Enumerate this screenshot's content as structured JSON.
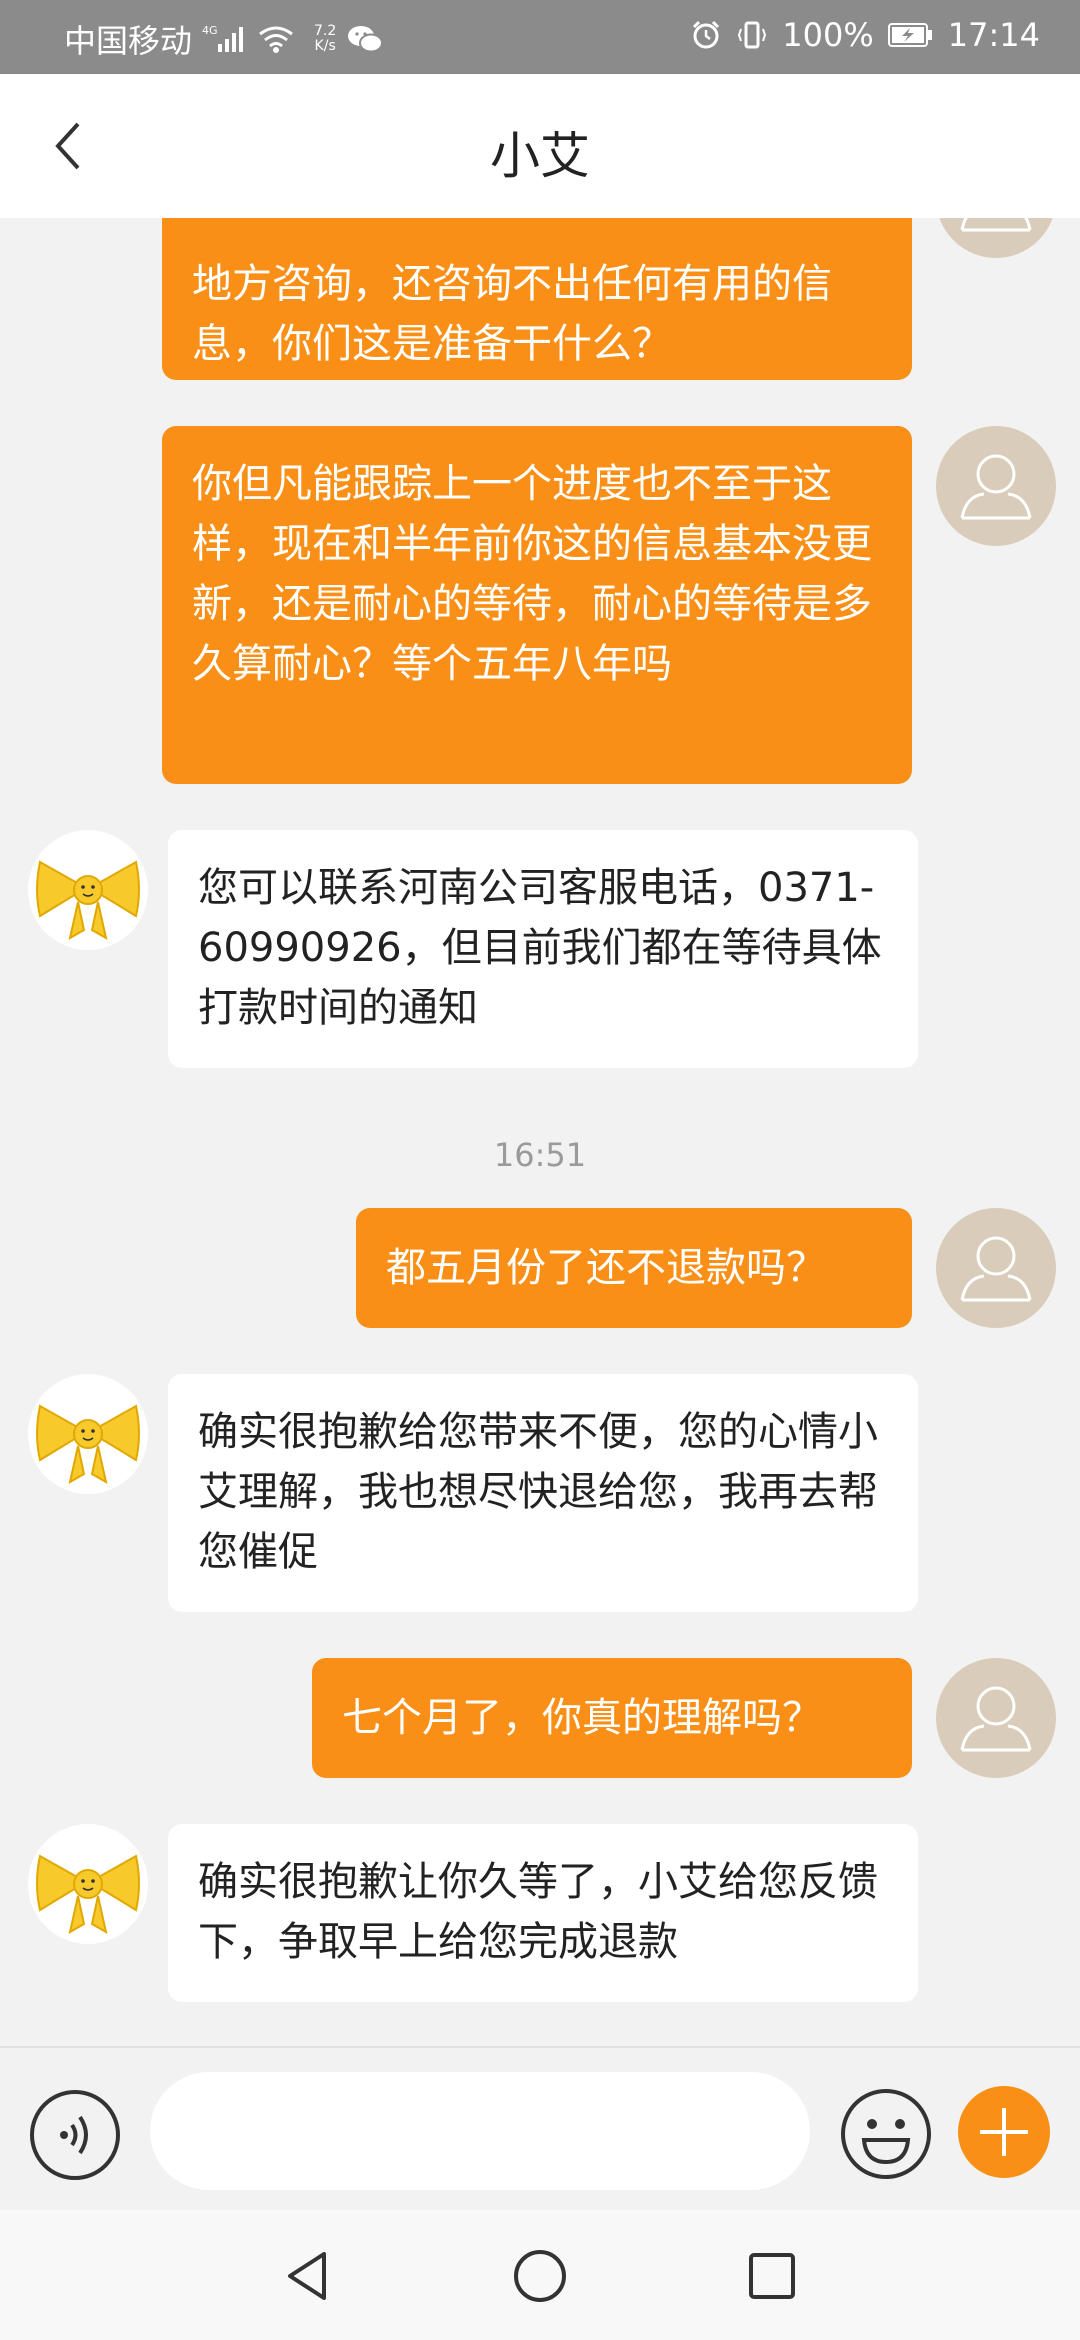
{
  "status_bar": {
    "carrier": "中国移动",
    "network_type": "4G",
    "speed_value": "7.2",
    "speed_unit": "K/s",
    "battery": "100%",
    "time": "17:14"
  },
  "header": {
    "title": "小艾"
  },
  "messages": [
    {
      "side": "out",
      "text": "地方咨询，还咨询不出任何有用的信息，你们这是准备干什么？"
    },
    {
      "side": "out",
      "text": "你但凡能跟踪上一个进度也不至于这样，现在和半年前你这的信息基本没更新，还是耐心的等待，耐心的等待是多久算耐心？等个五年八年吗"
    },
    {
      "side": "in",
      "text": "您可以联系河南公司客服电话，0371-60990926，但目前我们都在等待具体打款时间的通知"
    },
    {
      "side": "time",
      "text": "16:51"
    },
    {
      "side": "out",
      "text": "都五月份了还不退款吗？"
    },
    {
      "side": "in",
      "text": "确实很抱歉给您带来不便，您的心情小艾理解，我也想尽快退给您，我再去帮您催促"
    },
    {
      "side": "out",
      "text": "七个月了，你真的理解吗？"
    },
    {
      "side": "in",
      "text": "确实很抱歉让你久等了，小艾给您反馈下，争取早上给您完成退款"
    }
  ],
  "input": {
    "placeholder": ""
  },
  "icons": {
    "back": "back-arrow-icon",
    "voice": "voice-icon",
    "emoji": "emoji-icon",
    "plus": "plus-icon",
    "nav_back": "nav-back-icon",
    "nav_home": "nav-home-icon",
    "nav_recents": "nav-recents-icon"
  },
  "colors": {
    "accent": "#f98f16",
    "status_bar": "#8b8b8b",
    "background": "#f2f2f2"
  }
}
